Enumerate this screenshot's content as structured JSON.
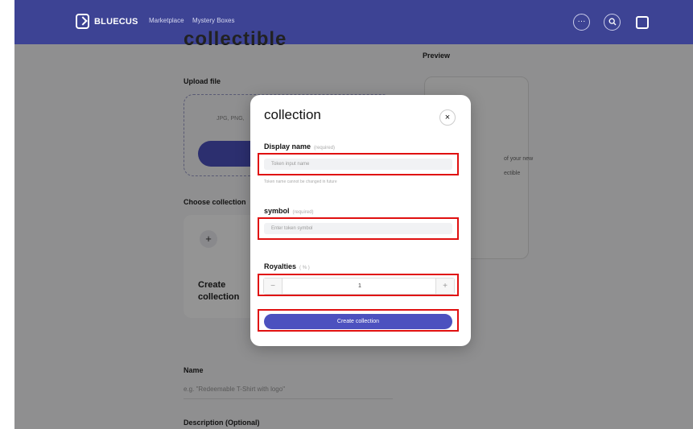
{
  "header": {
    "logo_text": "BLUECUS",
    "nav": [
      "Marketplace",
      "Mystery Boxes"
    ],
    "icons": [
      "more-icon",
      "search-icon",
      "profile-logo-icon"
    ]
  },
  "page": {
    "title": "collectible",
    "upload_label": "Upload file",
    "upload_hint": "JPG, PNG,",
    "preview_label": "Preview",
    "preview_text_1": "of your new",
    "preview_text_2": "ectible",
    "choose_collection_label": "Choose collection",
    "create_collection_card": "Create collection",
    "name_label": "Name",
    "name_placeholder": "e.g. \"Redeemable T-Shirt with logo\"",
    "description_label": "Description (Optional)"
  },
  "modal": {
    "title": "collection",
    "display_name_label": "Display name",
    "display_name_required": "(required)",
    "display_name_placeholder": "Token input name",
    "display_name_helper": "Token name cannot be changed in future",
    "symbol_label": "symbol",
    "symbol_required": "(required)",
    "symbol_placeholder": "Enter token symbol",
    "royalties_label": "Royalties",
    "royalties_unit": "( % )",
    "royalties_value": "1",
    "minus": "−",
    "plus": "+",
    "close": "×",
    "create_button": "Create collection"
  },
  "colors": {
    "header_bg": "#3d4394",
    "primary": "#4c51bf",
    "highlight": "#e01010"
  }
}
